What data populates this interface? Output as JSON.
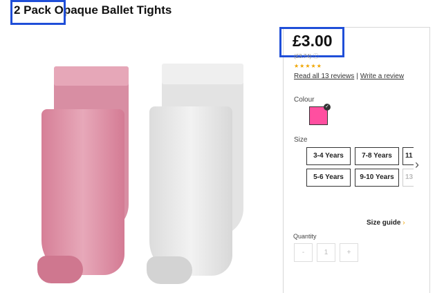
{
  "product": {
    "title": "2 Pack Opaque Ballet Tights"
  },
  "pricing": {
    "price": "£3.00",
    "was_price": "(£3.74) ⓘ",
    "stars": "★★★★★",
    "read_reviews": "Read all 13 reviews",
    "separator": "|",
    "write_review": "Write a review"
  },
  "colour": {
    "label": "Colour",
    "selected_colour": "#ff4fa0"
  },
  "size": {
    "label": "Size",
    "options": [
      "3-4 Years",
      "7-8 Years",
      "11",
      "5-6 Years",
      "9-10 Years",
      "13"
    ],
    "next_icon": "chevron-right-icon",
    "size_guide_label": "Size guide",
    "size_guide_arrow": "›"
  },
  "quantity": {
    "label": "Quantity",
    "minus": "-",
    "value": "1",
    "plus": "+"
  },
  "colors": {
    "highlight": "#1f4ed8",
    "accent": "#f0a500"
  }
}
